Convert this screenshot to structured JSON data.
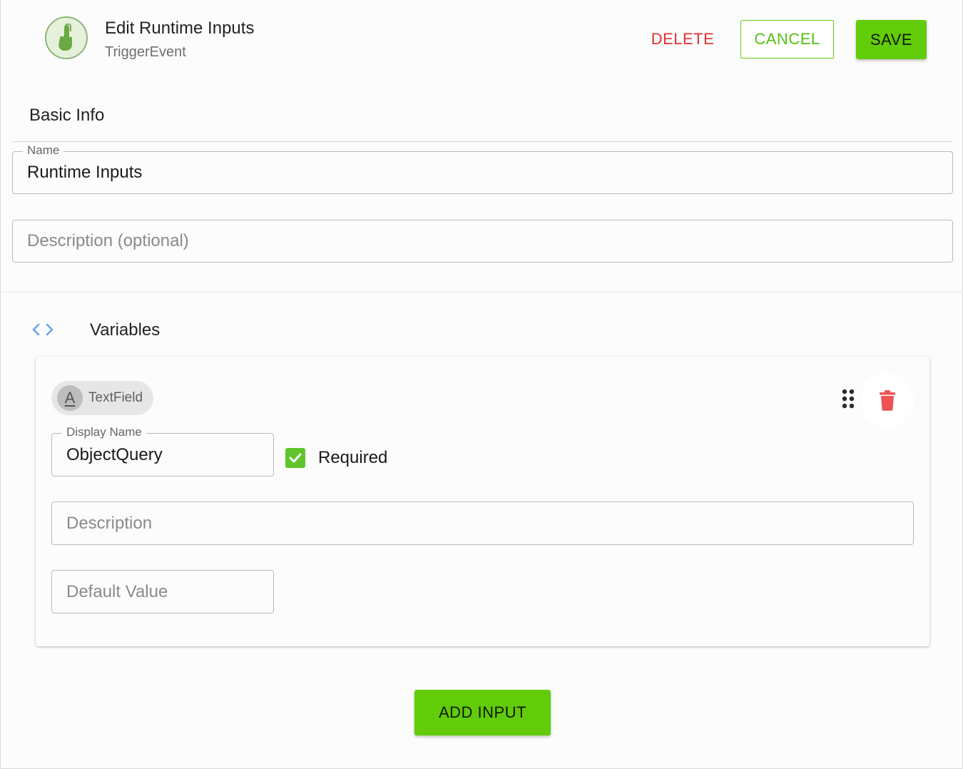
{
  "header": {
    "title": "Edit Runtime Inputs",
    "subtitle": "TriggerEvent",
    "app_icon": "touch-hand-icon",
    "delete_label": "DELETE",
    "cancel_label": "CANCEL",
    "save_label": "SAVE"
  },
  "basic_info": {
    "heading": "Basic Info",
    "name_label": "Name",
    "name_value": "Runtime Inputs",
    "description_placeholder": "Description (optional)"
  },
  "variables": {
    "heading": "Variables",
    "icon": "code-brackets-icon",
    "items": [
      {
        "type_label": "TextField",
        "type_avatar": "A",
        "display_name_label": "Display Name",
        "display_name_value": "ObjectQuery",
        "required_label": "Required",
        "required_checked": true,
        "description_placeholder": "Description",
        "default_value_placeholder": "Default Value",
        "drag_icon": "drag-handle-icon",
        "delete_icon": "trash-icon"
      }
    ],
    "add_label": "ADD INPUT"
  },
  "colors": {
    "primary_green": "#62cc0a",
    "delete_red": "#e23030",
    "trash_red": "#ec5454",
    "checkbox_green": "#5fc52a"
  }
}
